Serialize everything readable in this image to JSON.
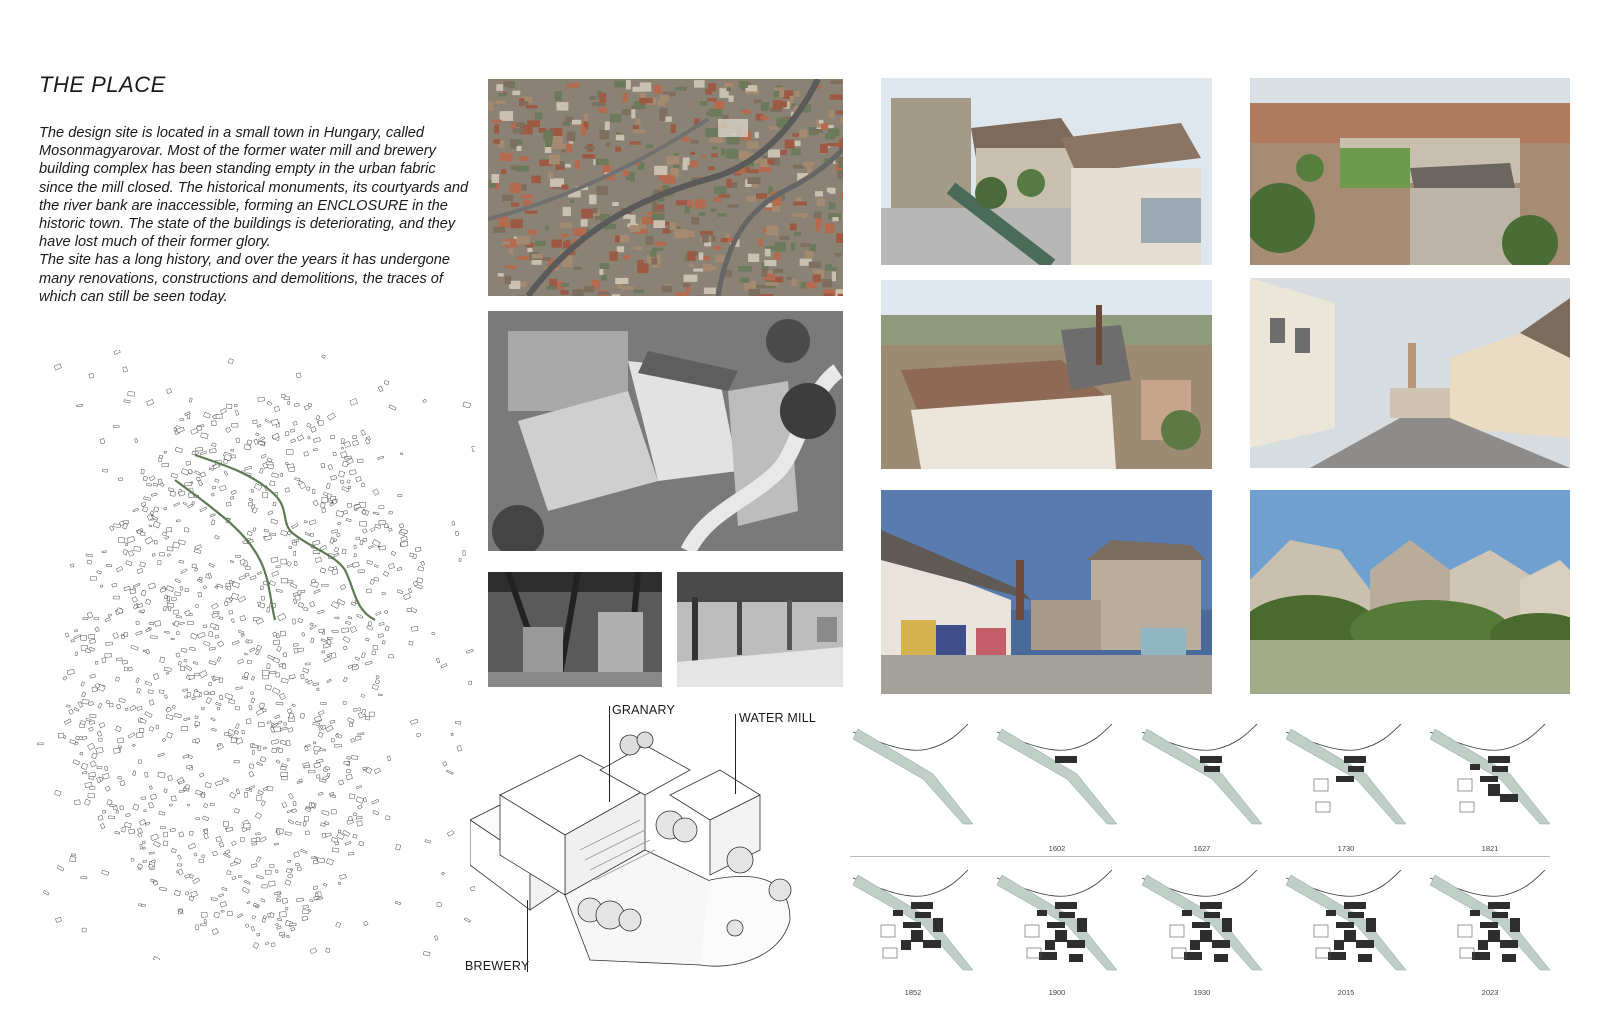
{
  "title": "THE PLACE",
  "description": {
    "paragraph1": "The design site is located in a small town in Hungary, called Mosonmagyarovar. Most of the former water mill and brewery building complex has been standing empty in the urban fabric since the mill closed. The historical monuments, its courtyards and the river bank are inaccessible, forming an ENCLOSURE in the historic town. The state of the buildings is deteriorating, and they have lost much of their former glory.",
    "paragraph2": "The site has a long history, and over the years it has undergone many renovations, constructions and demolitions, the traces of which can still be seen today."
  },
  "axonometric_labels": {
    "granary": "GRANARY",
    "water_mill": "WATER MILL",
    "brewery": "BREWERY"
  },
  "timeline": {
    "row1": [
      "",
      "1602",
      "1627",
      "1730",
      "1821"
    ],
    "row2": [
      "1852",
      "1900",
      "1930",
      "2015",
      "2023"
    ]
  },
  "colors": {
    "river": "#5e7a52",
    "river_plan": "#bfcfc8",
    "building_dark": "#2e2e2e"
  }
}
